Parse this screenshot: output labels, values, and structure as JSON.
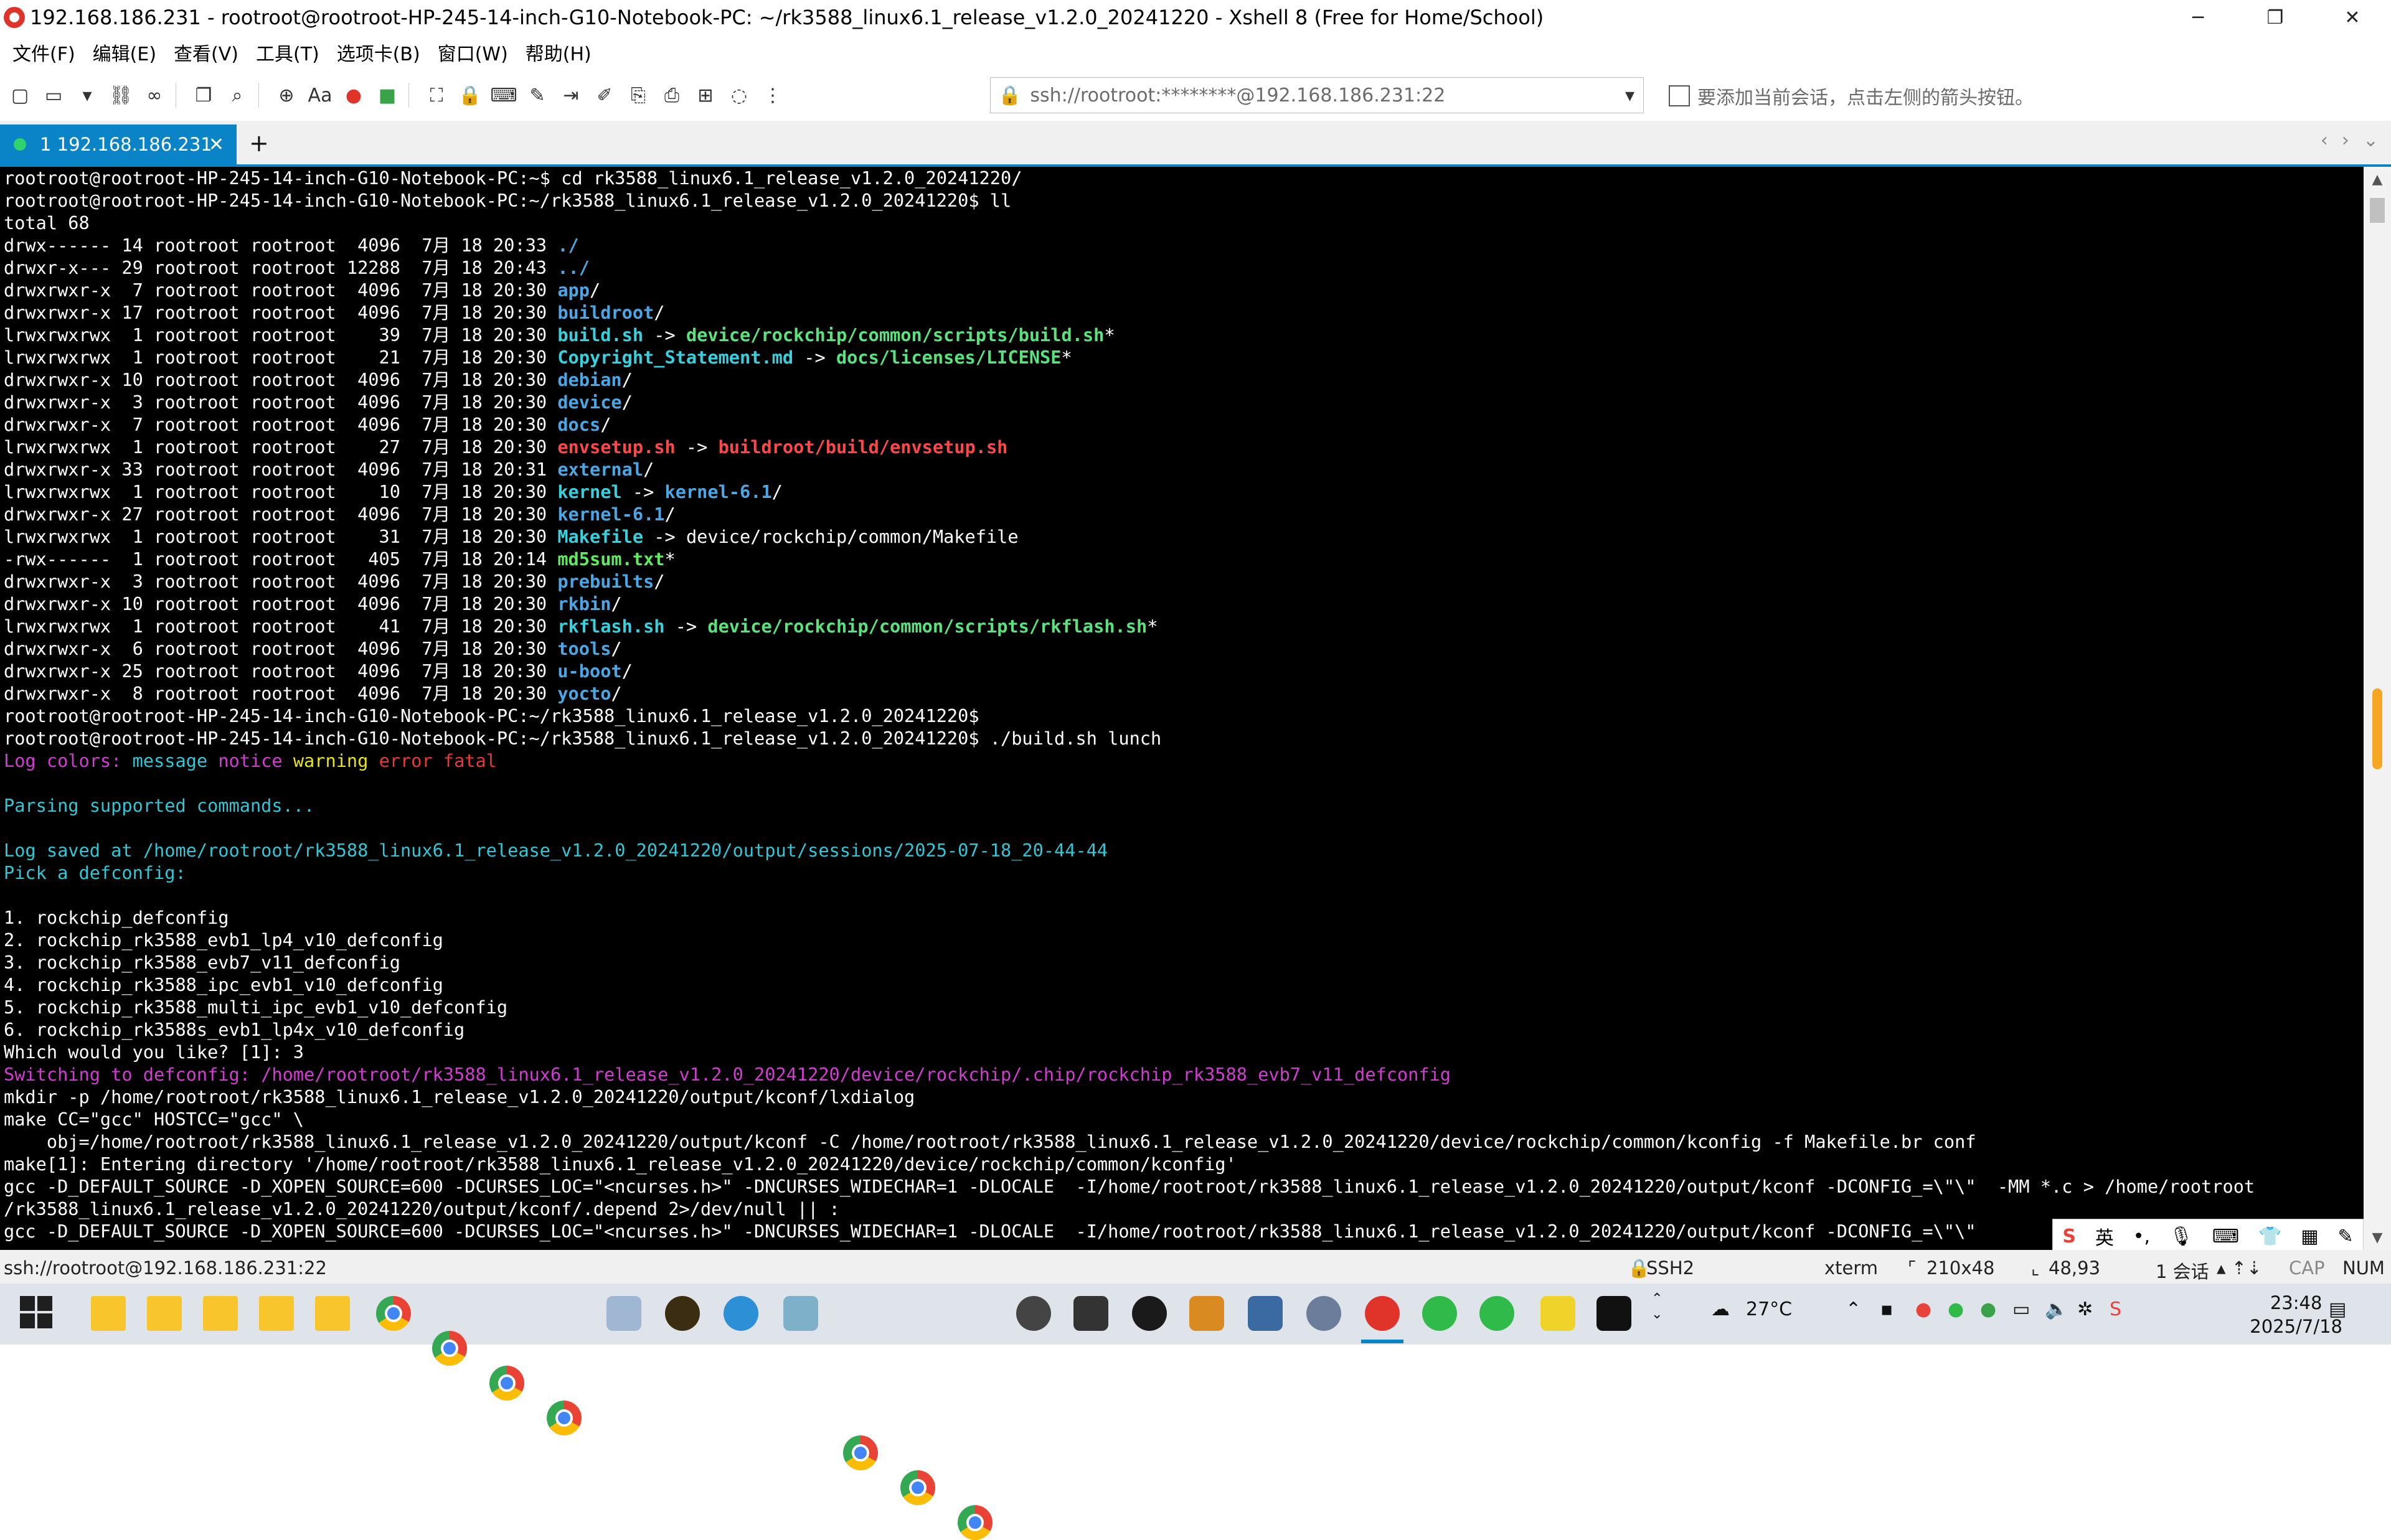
{
  "window": {
    "title": "192.168.186.231 - rootroot@rootroot-HP-245-14-inch-G10-Notebook-PC: ~/rk3588_linux6.1_release_v1.2.0_20241220 - Xshell 8 (Free for Home/School)",
    "controls": [
      "─",
      "❐",
      "✕"
    ]
  },
  "menu": [
    "文件(F)",
    "编辑(E)",
    "查看(V)",
    "工具(T)",
    "选项卡(B)",
    "窗口(W)",
    "帮助(H)"
  ],
  "toolbar": {
    "address": "ssh://rootroot:********@192.168.186.231:22",
    "font_label": "Aa",
    "session_hint": "要添加当前会话，点击左侧的箭头按钮。"
  },
  "tab": {
    "label": "1 192.168.186.231",
    "close": "✕",
    "add": "+",
    "nav_left": "‹",
    "nav_right": "›",
    "nav_menu": "⌄"
  },
  "terminal": {
    "lines": [
      [
        [
          "n",
          "rootroot@rootroot-HP-245-14-inch-G10-Notebook-PC:~$ cd rk3588_linux6.1_release_v1.2.0_20241220/"
        ]
      ],
      [
        [
          "n",
          "rootroot@rootroot-HP-245-14-inch-G10-Notebook-PC:~/rk3588_linux6.1_release_v1.2.0_20241220$ ll"
        ]
      ],
      [
        [
          "n",
          "total 68"
        ]
      ],
      [
        [
          "n",
          "drwx------ 14 rootroot rootroot  4096  7月 18 20:33 "
        ],
        [
          "dir",
          "./"
        ]
      ],
      [
        [
          "n",
          "drwxr-x--- 29 rootroot rootroot 12288  7月 18 20:43 "
        ],
        [
          "dir",
          "../"
        ]
      ],
      [
        [
          "n",
          "drwxrwxr-x  7 rootroot rootroot  4096  7月 18 20:30 "
        ],
        [
          "dir",
          "app"
        ],
        [
          "n",
          "/"
        ]
      ],
      [
        [
          "n",
          "drwxrwxr-x 17 rootroot rootroot  4096  7月 18 20:30 "
        ],
        [
          "dir",
          "buildroot"
        ],
        [
          "n",
          "/"
        ]
      ],
      [
        [
          "n",
          "lrwxrwxrwx  1 rootroot rootroot    39  7月 18 20:30 "
        ],
        [
          "link",
          "build.sh"
        ],
        [
          "n",
          " -> "
        ],
        [
          "lt",
          "device/rockchip/common/scripts/build.sh"
        ],
        [
          "n",
          "*"
        ]
      ],
      [
        [
          "n",
          "lrwxrwxrwx  1 rootroot rootroot    21  7月 18 20:30 "
        ],
        [
          "link",
          "Copyright_Statement.md"
        ],
        [
          "n",
          " -> "
        ],
        [
          "lt",
          "docs/licenses/LICENSE"
        ],
        [
          "n",
          "*"
        ]
      ],
      [
        [
          "n",
          "drwxrwxr-x 10 rootroot rootroot  4096  7月 18 20:30 "
        ],
        [
          "dir",
          "debian"
        ],
        [
          "n",
          "/"
        ]
      ],
      [
        [
          "n",
          "drwxrwxr-x  3 rootroot rootroot  4096  7月 18 20:30 "
        ],
        [
          "dir",
          "device"
        ],
        [
          "n",
          "/"
        ]
      ],
      [
        [
          "n",
          "drwxrwxr-x  7 rootroot rootroot  4096  7月 18 20:30 "
        ],
        [
          "dir",
          "docs"
        ],
        [
          "n",
          "/"
        ]
      ],
      [
        [
          "n",
          "lrwxrwxrwx  1 rootroot rootroot    27  7月 18 20:30 "
        ],
        [
          "red",
          "envsetup.sh"
        ],
        [
          "n",
          " -> "
        ],
        [
          "red",
          "buildroot/build/envsetup.sh"
        ]
      ],
      [
        [
          "n",
          "drwxrwxr-x 33 rootroot rootroot  4096  7月 18 20:31 "
        ],
        [
          "dir",
          "external"
        ],
        [
          "n",
          "/"
        ]
      ],
      [
        [
          "n",
          "lrwxrwxrwx  1 rootroot rootroot    10  7月 18 20:30 "
        ],
        [
          "link",
          "kernel"
        ],
        [
          "n",
          " -> "
        ],
        [
          "dir",
          "kernel-6.1"
        ],
        [
          "n",
          "/"
        ]
      ],
      [
        [
          "n",
          "drwxrwxr-x 27 rootroot rootroot  4096  7月 18 20:30 "
        ],
        [
          "dir",
          "kernel-6.1"
        ],
        [
          "n",
          "/"
        ]
      ],
      [
        [
          "n",
          "lrwxrwxrwx  1 rootroot rootroot    31  7月 18 20:30 "
        ],
        [
          "link",
          "Makefile"
        ],
        [
          "n",
          " -> device/rockchip/common/Makefile"
        ]
      ],
      [
        [
          "n",
          "-rwx------  1 rootroot rootroot   405  7月 18 20:14 "
        ],
        [
          "exec",
          "md5sum.txt"
        ],
        [
          "n",
          "*"
        ]
      ],
      [
        [
          "n",
          "drwxrwxr-x  3 rootroot rootroot  4096  7月 18 20:30 "
        ],
        [
          "dir",
          "prebuilts"
        ],
        [
          "n",
          "/"
        ]
      ],
      [
        [
          "n",
          "drwxrwxr-x 10 rootroot rootroot  4096  7月 18 20:30 "
        ],
        [
          "dir",
          "rkbin"
        ],
        [
          "n",
          "/"
        ]
      ],
      [
        [
          "n",
          "lrwxrwxrwx  1 rootroot rootroot    41  7月 18 20:30 "
        ],
        [
          "link",
          "rkflash.sh"
        ],
        [
          "n",
          " -> "
        ],
        [
          "lt",
          "device/rockchip/common/scripts/rkflash.sh"
        ],
        [
          "n",
          "*"
        ]
      ],
      [
        [
          "n",
          "drwxrwxr-x  6 rootroot rootroot  4096  7月 18 20:30 "
        ],
        [
          "dir",
          "tools"
        ],
        [
          "n",
          "/"
        ]
      ],
      [
        [
          "n",
          "drwxrwxr-x 25 rootroot rootroot  4096  7月 18 20:30 "
        ],
        [
          "dir",
          "u-boot"
        ],
        [
          "n",
          "/"
        ]
      ],
      [
        [
          "n",
          "drwxrwxr-x  8 rootroot rootroot  4096  7月 18 20:30 "
        ],
        [
          "dir",
          "yocto"
        ],
        [
          "n",
          "/"
        ]
      ],
      [
        [
          "n",
          "rootroot@rootroot-HP-245-14-inch-G10-Notebook-PC:~/rk3588_linux6.1_release_v1.2.0_20241220$"
        ]
      ],
      [
        [
          "n",
          "rootroot@rootroot-HP-245-14-inch-G10-Notebook-PC:~/rk3588_linux6.1_release_v1.2.0_20241220$ ./build.sh lunch"
        ]
      ],
      [
        [
          "mag",
          "Log colors: "
        ],
        [
          "cyan",
          "message "
        ],
        [
          "mag",
          "notice "
        ],
        [
          "yel",
          "warning "
        ],
        [
          "redn",
          "error "
        ],
        [
          "redn",
          "fatal"
        ]
      ],
      [
        [
          "n",
          ""
        ]
      ],
      [
        [
          "cyan",
          "Parsing supported commands..."
        ]
      ],
      [
        [
          "n",
          ""
        ]
      ],
      [
        [
          "cyan",
          "Log saved at /home/rootroot/rk3588_linux6.1_release_v1.2.0_20241220/output/sessions/2025-07-18_20-44-44"
        ]
      ],
      [
        [
          "cyan",
          "Pick a defconfig:"
        ]
      ],
      [
        [
          "n",
          ""
        ]
      ],
      [
        [
          "n",
          "1. rockchip_defconfig"
        ]
      ],
      [
        [
          "n",
          "2. rockchip_rk3588_evb1_lp4_v10_defconfig"
        ]
      ],
      [
        [
          "n",
          "3. rockchip_rk3588_evb7_v11_defconfig"
        ]
      ],
      [
        [
          "n",
          "4. rockchip_rk3588_ipc_evb1_v10_defconfig"
        ]
      ],
      [
        [
          "n",
          "5. rockchip_rk3588_multi_ipc_evb1_v10_defconfig"
        ]
      ],
      [
        [
          "n",
          "6. rockchip_rk3588s_evb1_lp4x_v10_defconfig"
        ]
      ],
      [
        [
          "n",
          "Which would you like? [1]: 3"
        ]
      ],
      [
        [
          "mag",
          "Switching to defconfig: /home/rootroot/rk3588_linux6.1_release_v1.2.0_20241220/device/rockchip/.chip/rockchip_rk3588_evb7_v11_defconfig"
        ]
      ],
      [
        [
          "n",
          "mkdir -p /home/rootroot/rk3588_linux6.1_release_v1.2.0_20241220/output/kconf/lxdialog"
        ]
      ],
      [
        [
          "n",
          "make CC=\"gcc\" HOSTCC=\"gcc\" \\"
        ]
      ],
      [
        [
          "n",
          "    obj=/home/rootroot/rk3588_linux6.1_release_v1.2.0_20241220/output/kconf -C /home/rootroot/rk3588_linux6.1_release_v1.2.0_20241220/device/rockchip/common/kconfig -f Makefile.br conf"
        ]
      ],
      [
        [
          "n",
          "make[1]: Entering directory '/home/rootroot/rk3588_linux6.1_release_v1.2.0_20241220/device/rockchip/common/kconfig'"
        ]
      ],
      [
        [
          "n",
          "gcc -D_DEFAULT_SOURCE -D_XOPEN_SOURCE=600 -DCURSES_LOC=\"<ncurses.h>\" -DNCURSES_WIDECHAR=1 -DLOCALE  -I/home/rootroot/rk3588_linux6.1_release_v1.2.0_20241220/output/kconf -DCONFIG_=\\\"\\\"  -MM *.c > /home/rootroot"
        ]
      ],
      [
        [
          "n",
          "/rk3588_linux6.1_release_v1.2.0_20241220/output/kconf/.depend 2>/dev/null || :"
        ]
      ],
      [
        [
          "n",
          "gcc -D_DEFAULT_SOURCE -D_XOPEN_SOURCE=600 -DCURSES_LOC=\"<ncurses.h>\" -DNCURSES_WIDECHAR=1 -DLOCALE  -I/home/rootroot/rk3588_linux6.1_release_v1.2.0_20241220/output/kconf -DCONFIG_=\\\"\\\""
        ]
      ]
    ]
  },
  "ime": {
    "logo": "S",
    "lang": "英",
    "punct": "•,",
    "mic": "🎙",
    "kbd": "⌨",
    "skin": "👕",
    "grid": "▦",
    "pen": "✎"
  },
  "statusbar": {
    "address": "ssh://rootroot@192.168.186.231:22",
    "protocol": "SSH2",
    "term": "xterm",
    "size": "210x48",
    "cursor": "48,93",
    "sessions": "1 会话",
    "cap": "CAP",
    "num": "NUM"
  },
  "taskbar": {
    "weather": "27°C",
    "time": "23:48",
    "date": "2025/7/18"
  }
}
